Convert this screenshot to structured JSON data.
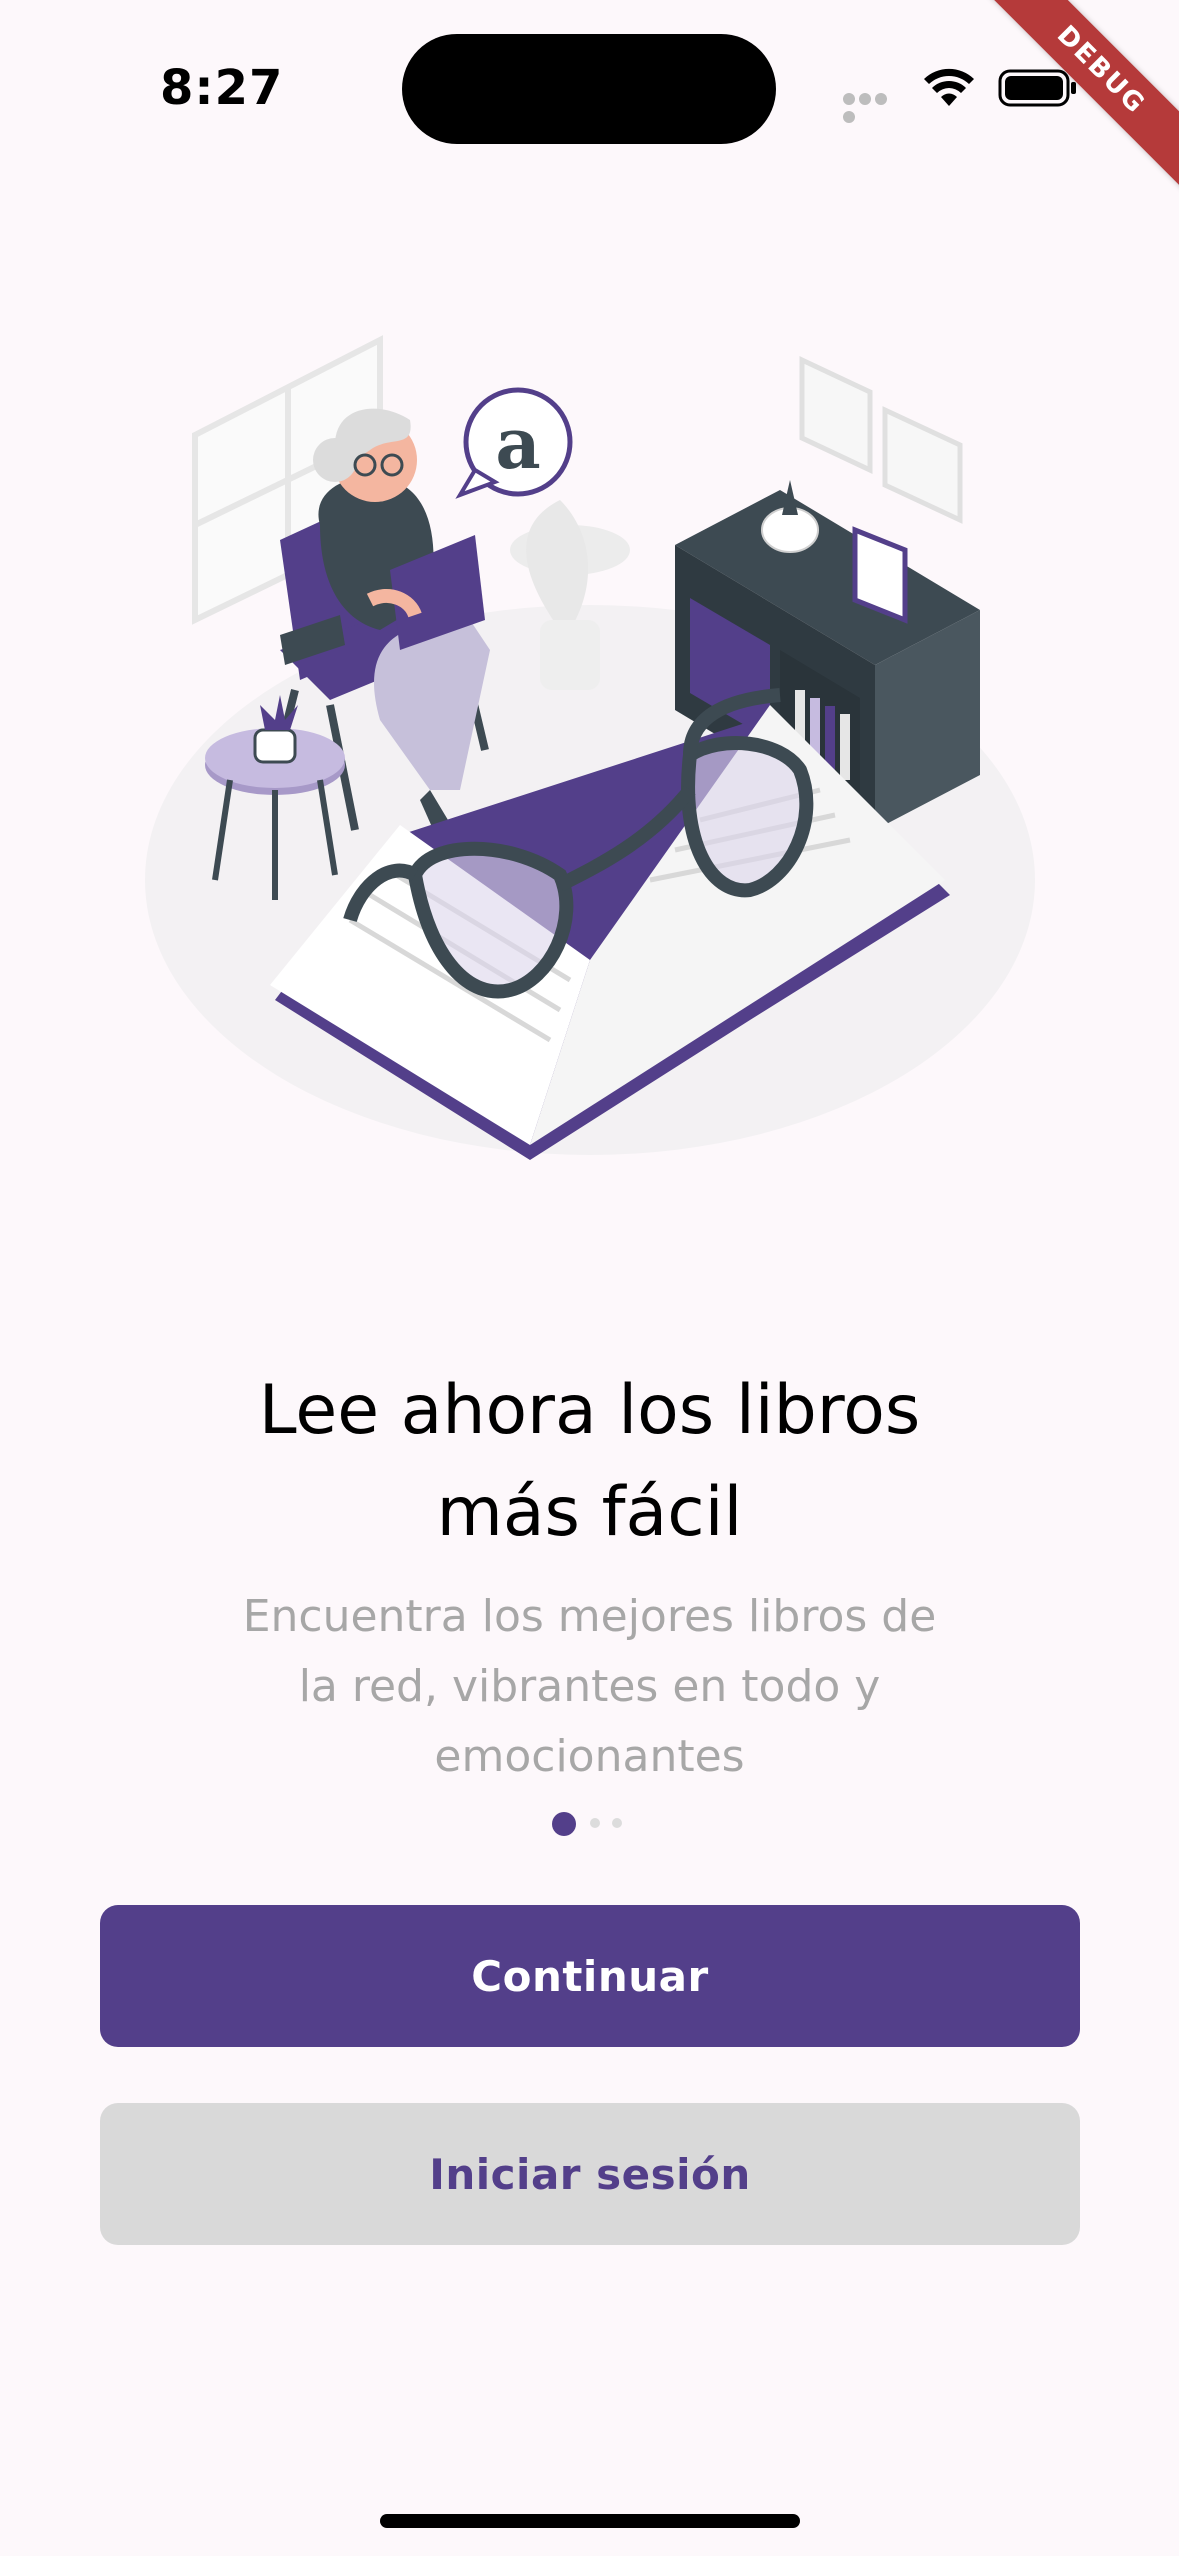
{
  "status_bar": {
    "time": "8:27",
    "debug_label": "DEBUG"
  },
  "illustration": {
    "bubble_letter": "a"
  },
  "onboarding": {
    "title_line1": "Lee ahora los libros",
    "title_line2": "más fácil",
    "subtitle_line1": "Encuentra los mejores libros de",
    "subtitle_line2": "la red, vibrantes en todo y",
    "subtitle_line3": "emocionantes",
    "current_page": 1,
    "total_pages": 3
  },
  "buttons": {
    "continue_label": "Continuar",
    "login_label": "Iniciar sesión"
  },
  "colors": {
    "primary": "#533f8a",
    "secondary_bg": "#d9d9d9",
    "background": "#fdf8fb",
    "subtitle": "#a7a7a7"
  }
}
